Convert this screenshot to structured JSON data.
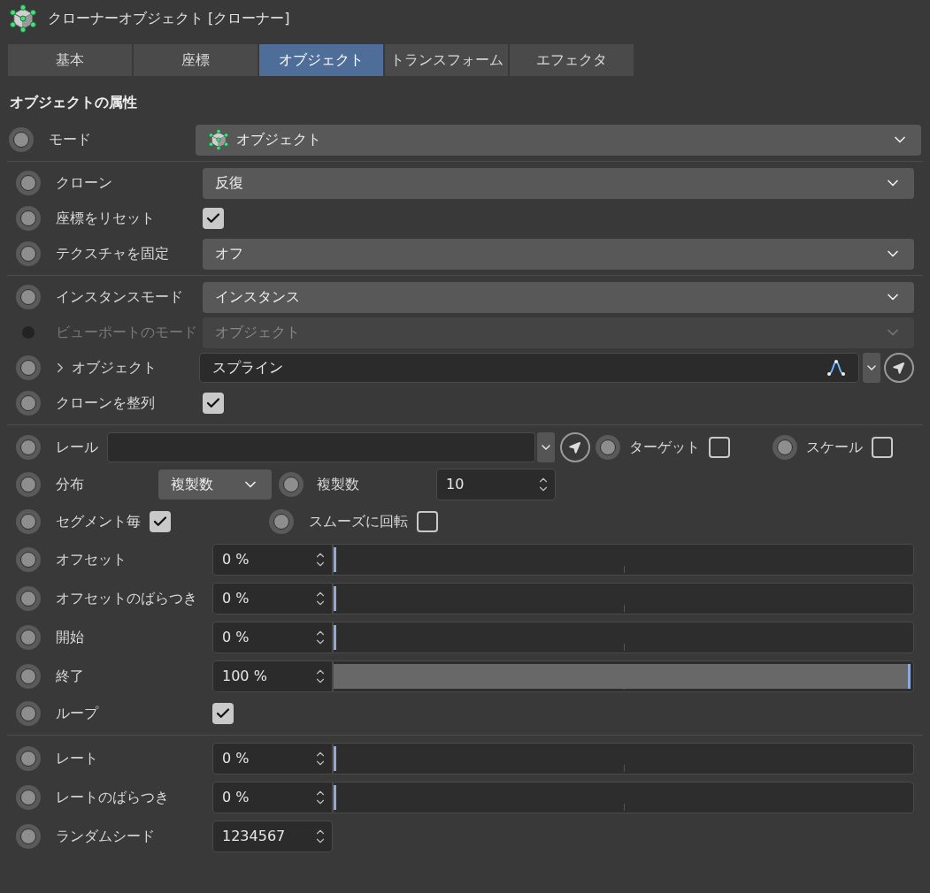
{
  "title": "クローナーオブジェクト [クローナー]",
  "tabs": [
    {
      "label": "基本",
      "selected": false
    },
    {
      "label": "座標",
      "selected": false
    },
    {
      "label": "オブジェクト",
      "selected": true
    },
    {
      "label": "トランスフォーム",
      "selected": false
    },
    {
      "label": "エフェクタ",
      "selected": false
    }
  ],
  "section_title": "オブジェクトの属性",
  "groups": [
    [
      {
        "kind": "dropdown",
        "label": "モード",
        "value": "オブジェクト",
        "icon": true,
        "disabled": false
      }
    ],
    [
      {
        "kind": "dropdown",
        "label": "クローン",
        "value": "反復",
        "icon": false,
        "disabled": false
      },
      {
        "kind": "checkbox",
        "label": "座標をリセット",
        "checked": true
      },
      {
        "kind": "dropdown",
        "label": "テクスチャを固定",
        "value": "オフ",
        "icon": false,
        "disabled": false
      }
    ],
    [
      {
        "kind": "dropdown",
        "label": "インスタンスモード",
        "value": "インスタンス",
        "icon": false,
        "disabled": false
      },
      {
        "kind": "dropdown",
        "label": "ビューポートのモード",
        "value": "オブジェクト",
        "icon": false,
        "disabled": true
      },
      {
        "kind": "link",
        "label": "オブジェクト",
        "value": "スプライン",
        "expanded": false
      },
      {
        "kind": "checkbox",
        "label": "クローンを整列",
        "checked": true
      }
    ],
    [
      {
        "kind": "rail",
        "label": "レール",
        "checks": [
          {
            "label": "ターゲット",
            "checked": false
          },
          {
            "label": "スケール",
            "checked": false
          }
        ]
      },
      {
        "kind": "distribution",
        "label": "分布",
        "mode": "複製数",
        "count_label": "複製数",
        "count": "10"
      },
      {
        "kind": "checks",
        "items": [
          {
            "label": "セグメント毎",
            "checked": true
          },
          {
            "label": "スムーズに回転",
            "checked": false
          }
        ]
      },
      {
        "kind": "slider",
        "label": "オフセット",
        "value": "0 %",
        "level": 0
      },
      {
        "kind": "slider",
        "label": "オフセットのばらつき",
        "value": "0 %",
        "level": 0
      },
      {
        "kind": "slider",
        "label": "開始",
        "value": "0 %",
        "level": 0
      },
      {
        "kind": "slider",
        "label": "終了",
        "value": "100 %",
        "level": 1
      },
      {
        "kind": "checkbox",
        "label": "ループ",
        "checked": true
      }
    ],
    [
      {
        "kind": "slider",
        "label": "レート",
        "value": "0 %",
        "level": 0
      },
      {
        "kind": "slider",
        "label": "レートのばらつき",
        "value": "0 %",
        "level": 0
      },
      {
        "kind": "number",
        "label": "ランダムシード",
        "value": "1234567"
      }
    ]
  ]
}
